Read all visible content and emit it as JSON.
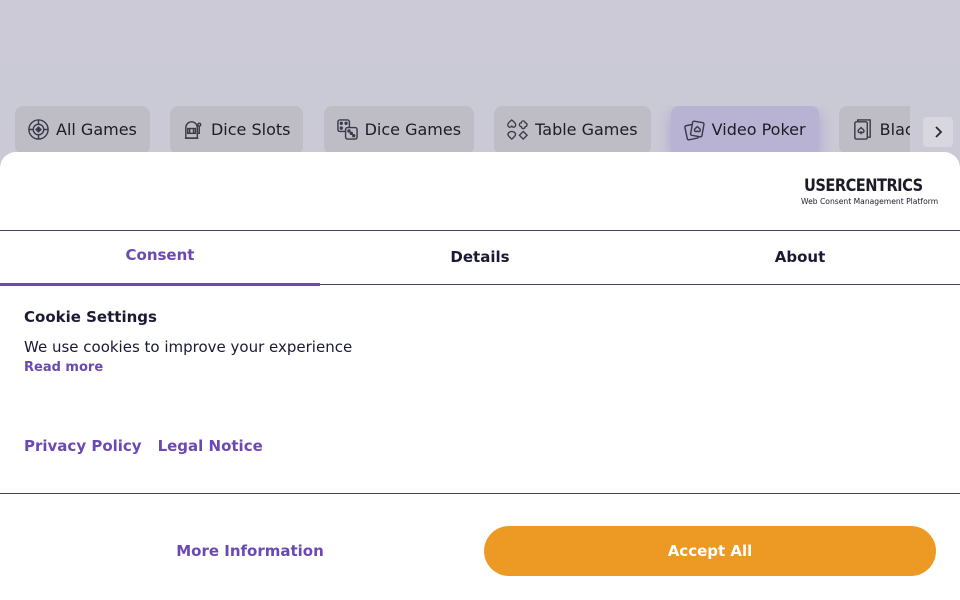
{
  "categories": [
    {
      "label": "All Games",
      "icon": "chip-icon",
      "active": false
    },
    {
      "label": "Dice Slots",
      "icon": "slot-machine-icon",
      "active": false
    },
    {
      "label": "Dice Games",
      "icon": "dice-icon",
      "active": false
    },
    {
      "label": "Table Games",
      "icon": "card-suits-icon",
      "active": false
    },
    {
      "label": "Video Poker",
      "icon": "poker-cards-icon",
      "active": true
    },
    {
      "label": "Blackjack",
      "icon": "blackjack-card-icon",
      "active": false
    }
  ],
  "scroll_arrow_icon": "chevron-right-icon",
  "consent": {
    "logo": {
      "name": "USERCENTRICS",
      "tagline": "Web Consent Management Platform",
      "icon": "shield-icon"
    },
    "tabs": [
      {
        "label": "Consent",
        "active": true
      },
      {
        "label": "Details",
        "active": false
      },
      {
        "label": "About",
        "active": false
      }
    ],
    "title": "Cookie Settings",
    "description": "We use cookies to improve your experience",
    "read_more": "Read more",
    "links": {
      "privacy": "Privacy Policy",
      "legal": "Legal Notice"
    },
    "buttons": {
      "more_info": "More Information",
      "accept_all": "Accept All"
    }
  },
  "colors": {
    "accent": "#6a49b3",
    "accept": "#ec9a24",
    "text": "#1a1a35"
  }
}
